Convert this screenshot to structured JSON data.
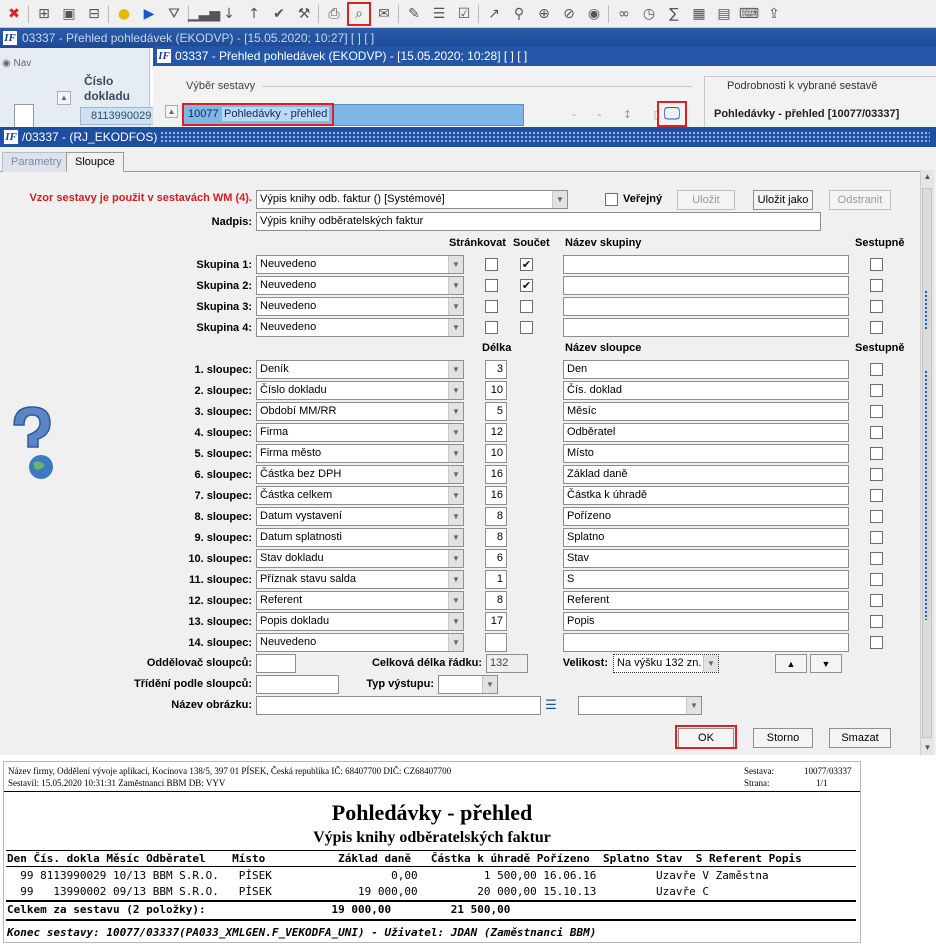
{
  "toolbar": {
    "icons": [
      "close-icon",
      "add-icon",
      "save-icon",
      "remove-icon",
      "help-icon",
      "run-icon",
      "filter-icon",
      "chart-icon",
      "sort-asc-icon",
      "sort-desc-icon",
      "check-icon",
      "wrench-icon",
      "print-icon",
      "print-preview-icon",
      "mail-icon",
      "edit-icon",
      "list-icon",
      "checklist-icon",
      "export-icon",
      "attach-icon",
      "web-icon",
      "compass-icon",
      "eye-icon",
      "glasses-icon",
      "clock-icon",
      "sum-icon",
      "excel-icon",
      "word-icon",
      "keyboard-icon",
      "share-icon"
    ]
  },
  "back_window": {
    "title": "03337 - Přehled pohledávek (EKODVP) - [15.05.2020; 10:27]  [ ]  [ ]",
    "nav_label": "Nav",
    "column_label": "Číslo dokladu",
    "doc_value": "8113990029"
  },
  "window2": {
    "title": "03337 - Přehled pohledávek (EKODVP) - [15.05.2020; 10:28]  [ ]  [ ]",
    "vyber_label": "Výběr sestavy",
    "sestava_code": "10077",
    "sestava_name": "Pohledávky - přehled",
    "podrob_label": "Podrobnosti k vybrané sestavě",
    "podrob_value": "Pohledávky - přehled [10077/03337]"
  },
  "dialog": {
    "title": "/03337 - (RJ_EKODFOS)",
    "tabs": [
      "Parametry",
      "Sloupce"
    ],
    "template_label": "Vzor sestavy je použit v sestavách WM (4).",
    "template_value": "Výpis knihy odb. faktur   ()   [Systémové]",
    "public_label": "Veřejný",
    "btn_save": "Uložit",
    "btn_save_as": "Uložit jako",
    "btn_delete_tpl": "Odstranit",
    "nadpis_label": "Nadpis:",
    "nadpis_value": "Výpis knihy odběratelských faktur",
    "hdr_pages": "Stránkovat",
    "hdr_sum": "Součet",
    "hdr_group_name": "Název skupiny",
    "hdr_desc": "Sestupně",
    "groups": [
      {
        "label": "Skupina 1:",
        "value": "Neuvedeno",
        "page": false,
        "sum": true,
        "name": "",
        "desc": false
      },
      {
        "label": "Skupina 2:",
        "value": "Neuvedeno",
        "page": false,
        "sum": true,
        "name": "",
        "desc": false
      },
      {
        "label": "Skupina 3:",
        "value": "Neuvedeno",
        "page": false,
        "sum": false,
        "name": "",
        "desc": false
      },
      {
        "label": "Skupina 4:",
        "value": "Neuvedeno",
        "page": false,
        "sum": false,
        "name": "",
        "desc": false
      }
    ],
    "hdr_len": "Délka",
    "hdr_col_name": "Název sloupce",
    "hdr_desc2": "Sestupně",
    "columns": [
      {
        "label": "1. sloupec:",
        "value": "Deník",
        "len": "3",
        "name": "Den"
      },
      {
        "label": "2. sloupec:",
        "value": "Číslo dokladu",
        "len": "10",
        "name": "Čís. doklad"
      },
      {
        "label": "3. sloupec:",
        "value": "Období MM/RR",
        "len": "5",
        "name": "Měsíc"
      },
      {
        "label": "4. sloupec:",
        "value": "Firma",
        "len": "12",
        "name": "Odběratel"
      },
      {
        "label": "5. sloupec:",
        "value": "Firma město",
        "len": "10",
        "name": "Místo"
      },
      {
        "label": "6. sloupec:",
        "value": "Částka bez DPH",
        "len": "16",
        "name": "Základ daně"
      },
      {
        "label": "7. sloupec:",
        "value": "Částka celkem",
        "len": "16",
        "name": "Částka k úhradě"
      },
      {
        "label": "8. sloupec:",
        "value": "Datum vystavení",
        "len": "8",
        "name": "Pořízeno"
      },
      {
        "label": "9. sloupec:",
        "value": "Datum splatnosti",
        "len": "8",
        "name": "Splatno"
      },
      {
        "label": "10. sloupec:",
        "value": "Stav dokladu",
        "len": "6",
        "name": "Stav"
      },
      {
        "label": "11. sloupec:",
        "value": "Příznak stavu salda",
        "len": "1",
        "name": "S"
      },
      {
        "label": "12. sloupec:",
        "value": "Referent",
        "len": "8",
        "name": "Referent"
      },
      {
        "label": "13. sloupec:",
        "value": "Popis dokladu",
        "len": "17",
        "name": "Popis"
      },
      {
        "label": "14. sloupec:",
        "value": "Neuvedeno",
        "len": "",
        "name": ""
      }
    ],
    "separator_label": "Oddělovač sloupců:",
    "separator_value": "",
    "total_len_label": "Celková délka řádku:",
    "total_len_value": "132",
    "size_label": "Velikost:",
    "size_value": "Na výšku 132 zn.",
    "sort_label": "Třídění podle sloupců:",
    "sort_value": "",
    "output_label": "Typ výstupu:",
    "output_value": "",
    "image_label": "Název obrázku:",
    "image_value": "",
    "btn_ok": "OK",
    "btn_cancel": "Storno",
    "btn_clear": "Smazat"
  },
  "report": {
    "company": "Název firmy, Oddělení vývoje aplikací, Kocínova 138/5, 397 01 PÍSEK, Česká republika  IČ: 68407700  DIČ: CZ68407700",
    "created": "Sestavil: 15.05.2020 10:31:31 Zaměstnanci BBM  DB: VYV",
    "sestava_label": "Sestava:",
    "sestava_value": "10077/03337",
    "page_label": "Strana:",
    "page_value": "1/1",
    "title": "Pohledávky - přehled",
    "subtitle": "Výpis knihy odběratelských faktur",
    "header_line": "Den Čís. dokla Měsíc Odběratel    Místo           Základ daně   Částka k úhradě Pořízeno  Splatno Stav  S Referent Popis",
    "rows": [
      "  99 8113990029 10/13 BBM S.R.O.   PÍSEK                  0,00          1 500,00 16.06.16         Uzavře V Zaměstna",
      "  99   13990002 09/13 BBM S.R.O.   PÍSEK             19 000,00         20 000,00 15.10.13         Uzavře C"
    ],
    "total_line": "Celkem za sestavu (2 položky):                   19 000,00         21 500,00",
    "footer": "Konec sestavy: 10077/03337(PA033_XMLGEN.F_VEKODFA_UNI) - Uživatel: JDAN (Zaměstnanci BBM)"
  }
}
